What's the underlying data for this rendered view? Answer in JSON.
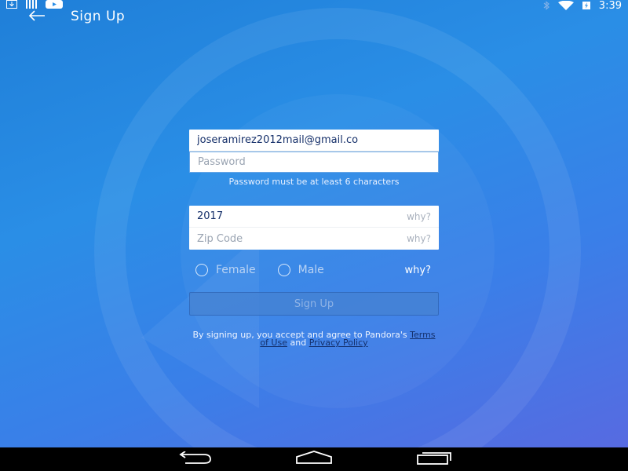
{
  "status_bar": {
    "time": "3:39",
    "left_icons": [
      "download-icon",
      "barcode-icon",
      "youtube-icon"
    ],
    "right_icons": [
      "bluetooth-icon",
      "wifi-icon",
      "battery-charging-icon"
    ]
  },
  "app_bar": {
    "back_icon": "arrow-left-icon",
    "title": "Sign Up"
  },
  "form": {
    "email": {
      "value": "joseramirez2012mail@gmail.co"
    },
    "password": {
      "placeholder": "Password",
      "value": ""
    },
    "password_helper": "Password must be at least 6 characters",
    "birth_year": {
      "value": "2017",
      "why": "why?"
    },
    "zip_code": {
      "placeholder": "Zip Code",
      "why": "why?"
    },
    "gender": {
      "options": [
        "Female",
        "Male"
      ],
      "selected": null,
      "why": "why?"
    },
    "submit_label": "Sign Up"
  },
  "terms": {
    "prefix": "By signing up, you accept and agree to Pandora's",
    "terms_link": "Terms of Use",
    "conjunction": "and",
    "privacy_link": "Privacy Policy"
  },
  "nav_bar": {
    "icons": [
      "back-nav-icon",
      "home-nav-icon",
      "recents-nav-icon"
    ]
  },
  "colors": {
    "background_start": "#1f7fd8",
    "background_end": "#5a68e0",
    "link": "#14316e",
    "nav_bar": "#000000"
  }
}
